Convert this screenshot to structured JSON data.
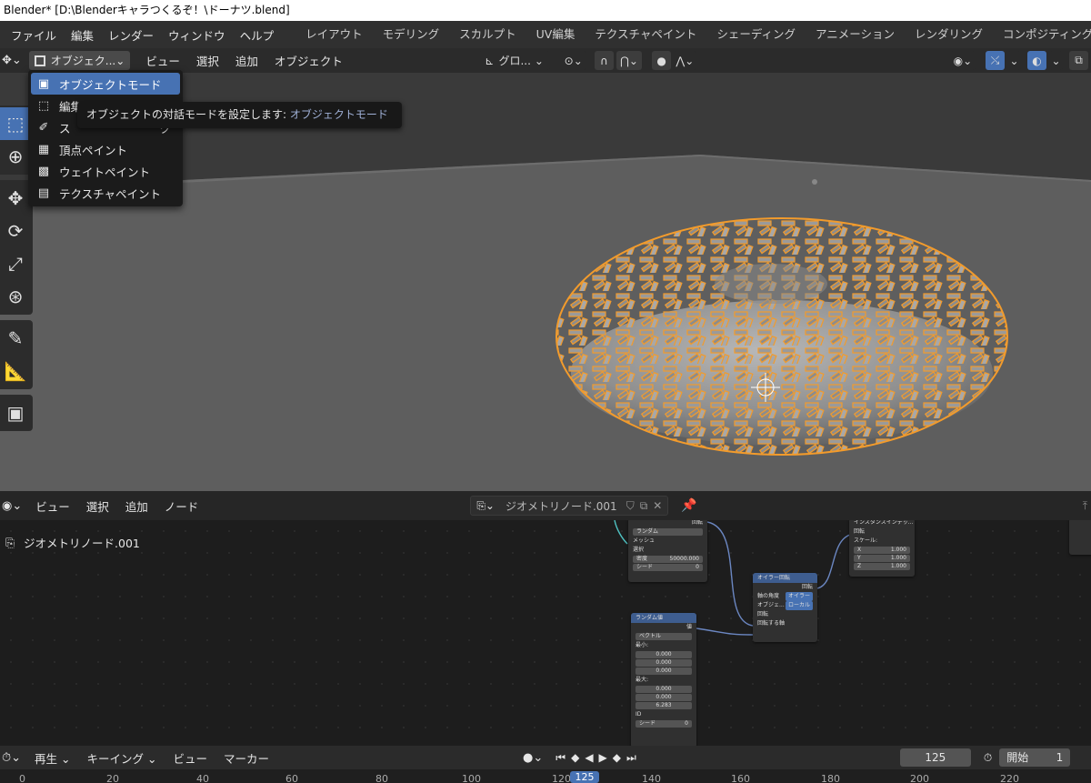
{
  "title": "Blender* [D:\\Blenderキャラつくるぞ！\\ドーナツ.blend]",
  "menu": [
    "ファイル",
    "編集",
    "レンダー",
    "ウィンドウ",
    "ヘルプ"
  ],
  "workspaces": [
    "レイアウト",
    "モデリング",
    "スカルプト",
    "UV編集",
    "テクスチャペイント",
    "シェーディング",
    "アニメーション",
    "レンダリング",
    "コンポジティング",
    "ジ"
  ],
  "viewport_header": {
    "mode": "オブジェク...",
    "menus": [
      "ビュー",
      "選択",
      "追加",
      "オブジェクト"
    ],
    "orientation": "グロ..."
  },
  "mode_menu": [
    {
      "label": "オブジェクトモード",
      "icon": "object-mode-icon"
    },
    {
      "label": "編集モード",
      "icon": "edit-mode-icon"
    },
    {
      "label": "スカルプトモード",
      "icon": "sculpt-mode-icon"
    },
    {
      "label": "頂点ペイント",
      "icon": "vertex-paint-icon"
    },
    {
      "label": "ウェイトペイント",
      "icon": "weight-paint-icon"
    },
    {
      "label": "テクスチャペイント",
      "icon": "texture-paint-icon"
    }
  ],
  "mode_menu_partial": {
    "item1": "編集",
    "item2": "ス",
    "item2_tail": "ク"
  },
  "tooltip": {
    "text": "オブジェクトの対話モードを設定します:",
    "value": "オブジェクトモード"
  },
  "node_editor": {
    "menus": [
      "ビュー",
      "選択",
      "追加",
      "ノード"
    ],
    "tree_name": "ジオメトリノード.001",
    "breadcrumb": "ジオメトリノード.001"
  },
  "nodes": {
    "distribute": {
      "mode": "ランダム",
      "out_rotation": "回転",
      "mesh": "メッシュ",
      "selection": "選択",
      "density_label": "密度",
      "density": "50000.000",
      "seed_label": "シード",
      "seed": "0"
    },
    "euler": {
      "title": "オイラー回転",
      "out": "回転",
      "axis_label": "軸の角度",
      "axis_value": "オイラー",
      "space_label": "オブジェ...",
      "space_value": "ローカル",
      "rotation": "回転",
      "rotate_by": "回転する軸"
    },
    "instance": {
      "title": "インスタンスインデッ...",
      "rotation": "回転",
      "scale": "スケール:",
      "x_label": "X",
      "x": "1.000",
      "y_label": "Y",
      "y": "1.000",
      "z_label": "Z",
      "z": "1.000"
    },
    "random": {
      "title": "ランダム値",
      "out": "値",
      "type": "ベクトル",
      "min_label": "最小:",
      "min": [
        "0.000",
        "0.000",
        "0.000"
      ],
      "max_label": "最大:",
      "max": [
        "0.000",
        "0.000",
        "6.283"
      ],
      "id": "ID",
      "seed_label": "シード",
      "seed": "0"
    }
  },
  "timeline": {
    "play": "再生",
    "keying": "キーイング",
    "view": "ビュー",
    "marker": "マーカー",
    "current_frame": "125",
    "start_label": "開始",
    "start": "1"
  },
  "ruler": [
    "0",
    "20",
    "40",
    "60",
    "80",
    "100",
    "120",
    "140",
    "160",
    "180",
    "200",
    "220"
  ],
  "colors": {
    "accent": "#4772b3",
    "selection": "#f29b2c",
    "viewport_bg": "#3d3d3d"
  }
}
